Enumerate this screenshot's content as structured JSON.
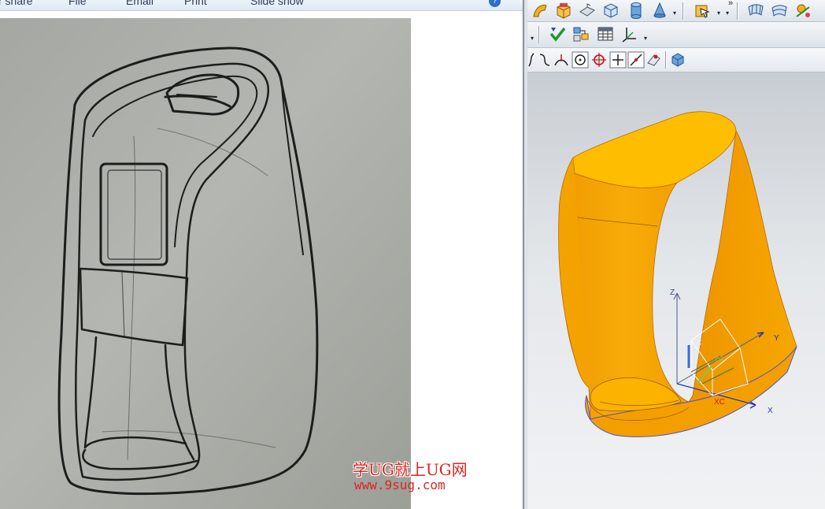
{
  "viewer": {
    "toolbar": {
      "items": [
        "r share",
        "File",
        "Email",
        "Print",
        "Slide show"
      ],
      "help_icon": "help-icon"
    },
    "photo": {
      "subject": "pencil sketch",
      "icon": "sketch-photo"
    },
    "watermark": {
      "title": "学UG就上UG网",
      "url": "www.9sug.com",
      "color": "#e0241f"
    }
  },
  "cad": {
    "toolbar_row_1": {
      "icons": [
        "sweep-icon",
        "block-feature-icon",
        "edge-blend-icon",
        "box-icon",
        "cylinder-icon",
        "cone-icon",
        "feature-operation-icon",
        "through-curves-mesh-icon",
        "studio-surface-icon",
        "more-surface-icon"
      ],
      "overflow_label": "»"
    },
    "toolbar_row_2": {
      "icons": [
        "check-geometry-icon",
        "assembly-navigator-icon",
        "data-table-icon",
        "coordinate-system-icon"
      ]
    },
    "toolbar_row_3": {
      "icons": [
        "spline-icon",
        "curve-icon",
        "intersection-curve-icon",
        "center-snap-icon",
        "quadrant-snap-icon",
        "existing-point-snap-icon",
        "on-curve-snap-icon",
        "face-snap-icon",
        "solid-body-filter-icon"
      ]
    },
    "graphics": {
      "model_color": "#f5a300",
      "csys_labels": {
        "z": "Z",
        "y": "Y",
        "zc": "ZC",
        "yc": "YC",
        "xc": "XC",
        "x": "X"
      }
    }
  }
}
